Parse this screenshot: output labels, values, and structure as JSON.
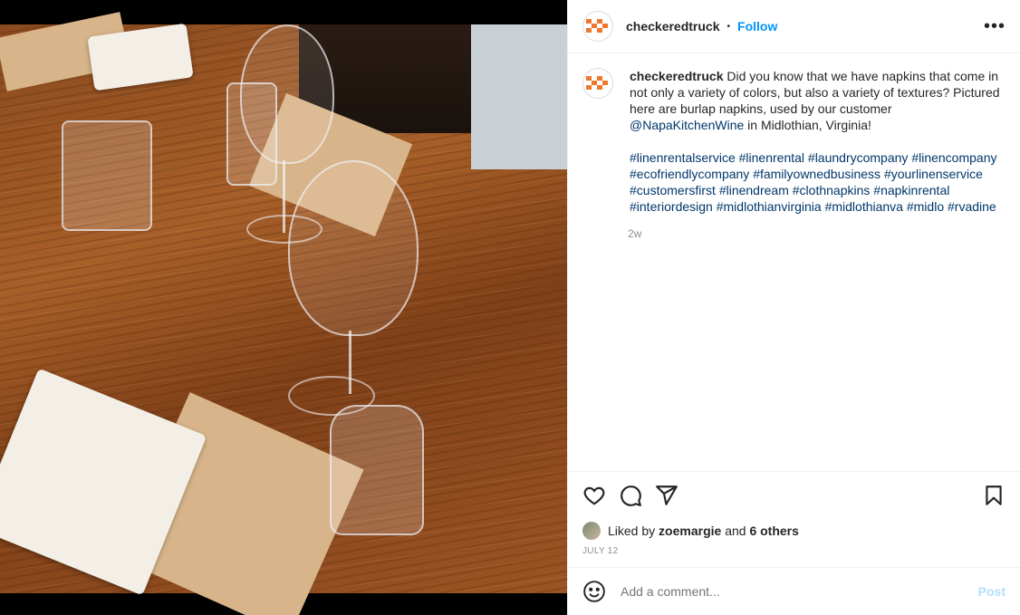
{
  "post": {
    "username": "checkeredtruck",
    "follow_label": "Follow",
    "more_label": "•••"
  },
  "caption": {
    "username": "checkeredtruck",
    "text_1": " Did you know that we have napkins that come in not only a variety of colors, but also a variety of textures? Pictured here are burlap napkins, used by our customer ",
    "mention": "@NapaKitchenWine",
    "text_2": " in Midlothian, Virginia!",
    "hashtags": [
      "#linenrentalservice",
      "#linenrental",
      "#laundrycompany",
      "#linencompany",
      "#ecofriendlycompany",
      "#familyownedbusiness",
      "#yourlinenservice",
      "#customersfirst",
      "#linendream",
      "#clothnapkins",
      "#napkinrental",
      "#interiordesign",
      "#midlothianvirginia",
      "#midlothianva",
      "#midlo",
      "#rvadine"
    ],
    "time": "2w"
  },
  "likes": {
    "prefix": "Liked by ",
    "user": "zoemargie",
    "middle": " and ",
    "others": "6 others"
  },
  "date": "JULY 12",
  "comment": {
    "placeholder": "Add a comment...",
    "post_label": "Post"
  },
  "icons": {
    "like": "heart-icon",
    "comment": "comment-icon",
    "share": "share-icon",
    "save": "bookmark-icon",
    "emoji": "emoji-icon"
  },
  "colors": {
    "accent": "#0095f6",
    "link": "#00376b",
    "brand": "#f0782e"
  }
}
